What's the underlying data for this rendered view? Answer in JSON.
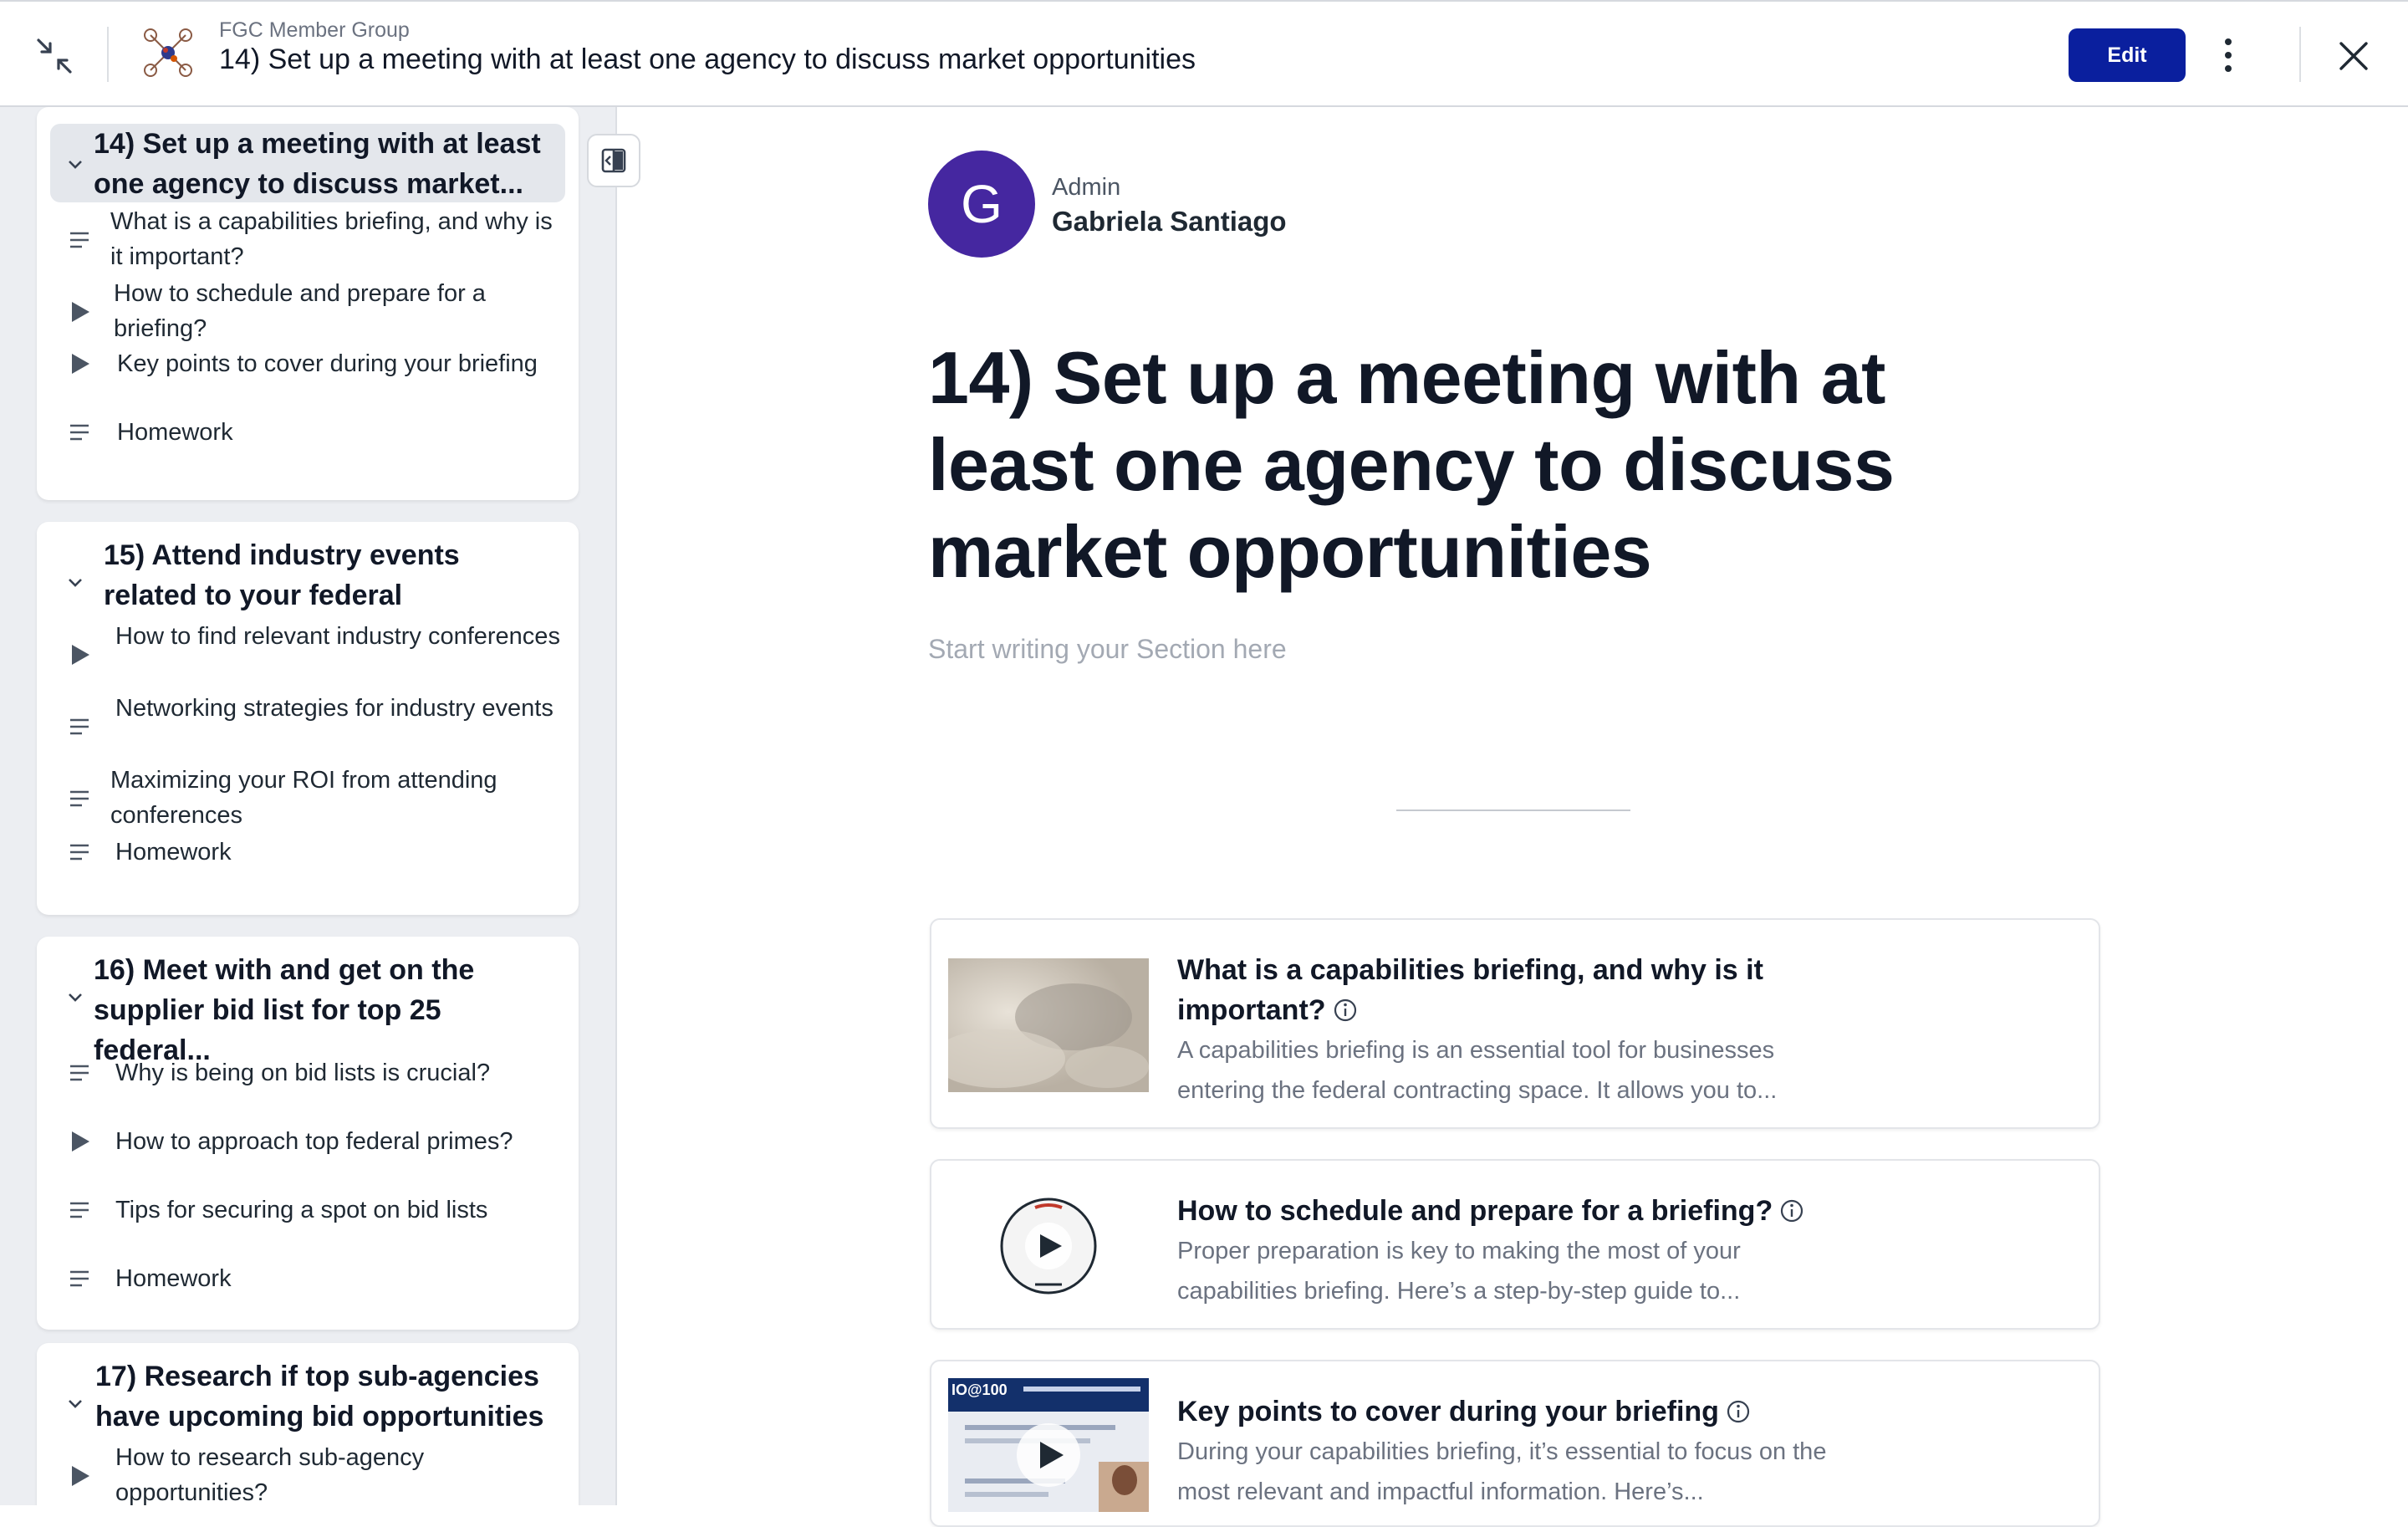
{
  "header": {
    "group": "FGC Member Group",
    "title": "14) Set up a meeting with at least one agency to discuss market opportunities",
    "edit_label": "Edit"
  },
  "sidebar": {
    "sections": [
      {
        "title": "14) Set up a meeting with at least one agency to discuss market...",
        "active": true,
        "lessons": [
          {
            "label": "What is a capabilities briefing, and why is it important?",
            "icon": "text-lines-icon"
          },
          {
            "label": "How to schedule and prepare for a briefing?",
            "icon": "play-icon"
          },
          {
            "label": "Key points to cover during your briefing",
            "icon": "play-icon"
          },
          {
            "label": "Homework",
            "icon": "text-lines-icon"
          }
        ]
      },
      {
        "title": "15) Attend industry events related to your federal",
        "lessons": [
          {
            "label": "How to find relevant industry conferences",
            "icon": "play-icon"
          },
          {
            "label": "Networking strategies for industry events",
            "icon": "text-lines-icon"
          },
          {
            "label": "Maximizing your ROI from attending conferences",
            "icon": "text-lines-icon"
          },
          {
            "label": "Homework",
            "icon": "text-lines-icon"
          }
        ]
      },
      {
        "title": "16) Meet with and get on the supplier bid list for top 25 federal...",
        "lessons": [
          {
            "label": "Why is being on bid lists is crucial?",
            "icon": "text-lines-icon"
          },
          {
            "label": "How to approach top federal primes?",
            "icon": "play-icon"
          },
          {
            "label": "Tips for securing a spot on bid lists",
            "icon": "text-lines-icon"
          },
          {
            "label": "Homework",
            "icon": "text-lines-icon"
          }
        ]
      },
      {
        "title": "17) Research if top sub-agencies have upcoming bid opportunities",
        "lessons": [
          {
            "label": "How to research sub-agency opportunities?",
            "icon": "play-icon"
          }
        ]
      }
    ]
  },
  "main": {
    "avatar_letter": "G",
    "author_role": "Admin",
    "author_name": "Gabriela Santiago",
    "title": "14) Set up a meeting with at least one agency to discuss market opportunities",
    "placeholder": "Start writing your Section here",
    "lessons": [
      {
        "title": "What is a capabilities briefing, and why is it important?",
        "desc": "A capabilities briefing is an essential tool for businesses entering the federal contracting space. It allows you to...",
        "thumb": "cloud-image"
      },
      {
        "title": "How to schedule and prepare for a briefing?",
        "desc": "Proper preparation is key to making the most of your capabilities briefing. Here’s a step-by-step guide to...",
        "thumb": "video-play-circle"
      },
      {
        "title": "Key points to cover during your briefing",
        "desc": "During your capabilities briefing, it’s essential to focus on the most relevant and impactful information. Here’s...",
        "thumb": "video-screenshot",
        "thumb_banner": "IO@100"
      }
    ]
  },
  "colors": {
    "edit_button": "#0a1f9e",
    "avatar": "#4527a0",
    "sidebar_bg": "#eceef2",
    "active_section_bg": "#e4e7ec"
  }
}
